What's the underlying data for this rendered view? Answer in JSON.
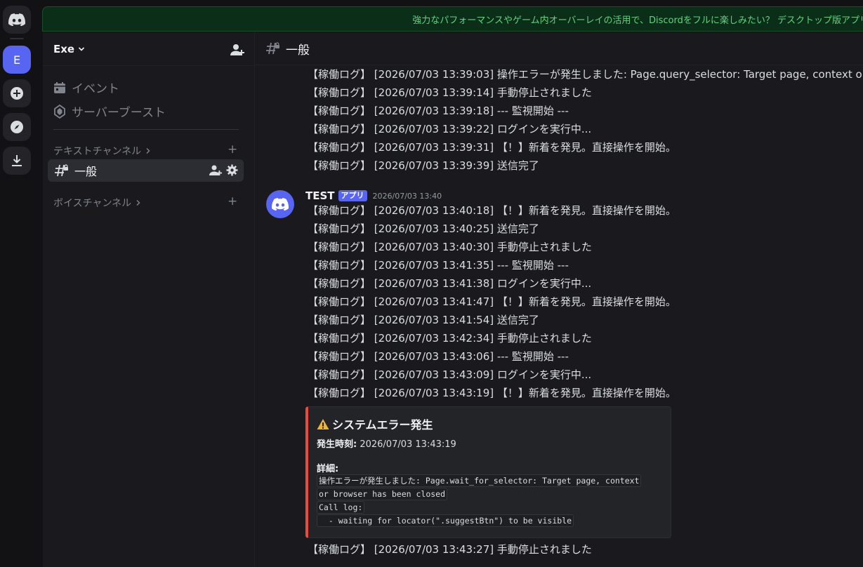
{
  "banner": {
    "text": "強力なパフォーマンスやゲーム内オーバーレイの活用で、Discordをフルに楽しみたい？ デスクトップ版アプリをどうぞ"
  },
  "rail": {
    "server_initial": "E"
  },
  "sidebar": {
    "guild_name": "Exe",
    "items": [
      {
        "label": "イベント"
      },
      {
        "label": "サーバーブースト"
      }
    ],
    "text_category": "テキストチャンネル",
    "voice_category": "ボイスチャンネル",
    "active_channel": "一般"
  },
  "channel": {
    "name": "一般"
  },
  "messages": {
    "earlier": [
      {
        "tag": "【稼働ログ】",
        "text": "[2026/07/03 13:39:03] 操作エラーが発生しました: Page.query_selector: Target page, context or browser has been closed"
      },
      {
        "tag": "【稼働ログ】",
        "text": "[2026/07/03 13:39:14] 手動停止されました"
      },
      {
        "tag": "【稼働ログ】",
        "text": "[2026/07/03 13:39:18] --- 監視開始 ---"
      },
      {
        "tag": "【稼働ログ】",
        "text": "[2026/07/03 13:39:22] ログインを実行中..."
      },
      {
        "tag": "【稼働ログ】",
        "text": "[2026/07/03 13:39:31] 【！】新着を発見。直接操作を開始。"
      },
      {
        "tag": "【稼働ログ】",
        "text": "[2026/07/03 13:39:39] 送信完了"
      }
    ],
    "author": "TEST",
    "app_badge": "アプリ",
    "timestamp": "2026/07/03 13:40",
    "group": [
      {
        "tag": "【稼働ログ】",
        "text": "[2026/07/03 13:40:18] 【！】新着を発見。直接操作を開始。"
      },
      {
        "tag": "【稼働ログ】",
        "text": "[2026/07/03 13:40:25] 送信完了"
      },
      {
        "tag": "【稼働ログ】",
        "text": "[2026/07/03 13:40:30] 手動停止されました"
      },
      {
        "tag": "【稼働ログ】",
        "text": "[2026/07/03 13:41:35] --- 監視開始 ---"
      },
      {
        "tag": "【稼働ログ】",
        "text": "[2026/07/03 13:41:38] ログインを実行中..."
      },
      {
        "tag": "【稼働ログ】",
        "text": "[2026/07/03 13:41:47] 【！】新着を発見。直接操作を開始。"
      },
      {
        "tag": "【稼働ログ】",
        "text": "[2026/07/03 13:41:54] 送信完了"
      },
      {
        "tag": "【稼働ログ】",
        "text": "[2026/07/03 13:42:34] 手動停止されました"
      },
      {
        "tag": "【稼働ログ】",
        "text": "[2026/07/03 13:43:06] --- 監視開始 ---"
      },
      {
        "tag": "【稼働ログ】",
        "text": "[2026/07/03 13:43:09] ログインを実行中..."
      },
      {
        "tag": "【稼働ログ】",
        "text": "[2026/07/03 13:43:19] 【！】新着を発見。直接操作を開始。"
      }
    ],
    "embed": {
      "title": "システムエラー発生",
      "time_label": "発生時刻:",
      "time_value": "2026/07/03 13:43:19",
      "detail_label": "詳細:",
      "code_lines": [
        "操作エラーが発生しました: Page.wait_for_selector: Target page, context",
        "or browser has been closed",
        "Call log:",
        "  - waiting for locator(\".suggestBtn\") to be visible"
      ]
    },
    "after": [
      {
        "tag": "【稼働ログ】",
        "text": "[2026/07/03 13:43:27] 手動停止されました"
      }
    ]
  }
}
